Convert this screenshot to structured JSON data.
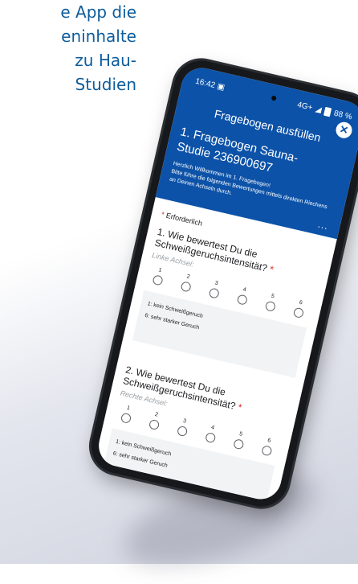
{
  "caption": {
    "lines": [
      "e App die",
      "eninhalte",
      "zu Hau-",
      "Studien"
    ]
  },
  "status_bar": {
    "time": "16:42",
    "sim_icon": "sim-icon",
    "network": "4G+",
    "battery": "88 %"
  },
  "header": {
    "title": "Fragebogen ausfüllen",
    "form_title": "1. Fragebogen Sauna-Studie 236900697",
    "welcome_line1": "Herzlich Willkommen im 1. Fragebogen!",
    "welcome_line2": "Bitte führe die folgenden Bewertungen mittels direkten Riechens",
    "welcome_line3": "an Deinen Achseln durch.",
    "more": "..."
  },
  "form": {
    "required_star": "*",
    "required_label": "Erforderlich",
    "questions": [
      {
        "text": "1. Wie bewertest Du die Schweißgeruchsintensität?",
        "star": "*",
        "sub": "Linke Achsel:",
        "options": [
          "1",
          "2",
          "3",
          "4",
          "5",
          "6"
        ],
        "legend_low": "1: kein Schweißgeruch",
        "legend_high": "6: sehr starker Geruch"
      },
      {
        "text": "2. Wie bewertest Du die Schweißgeruchsintensität?",
        "star": "*",
        "sub": "Rechte Achsel:",
        "options": [
          "1",
          "2",
          "3",
          "4",
          "5",
          "6"
        ],
        "legend_low": "1: kein Schweißgeruch",
        "legend_high": "6: sehr starker Geruch"
      }
    ]
  },
  "colors": {
    "header_bg": "#0c52a8",
    "caption_text": "#0d5c9c",
    "required_star": "#d93025"
  }
}
